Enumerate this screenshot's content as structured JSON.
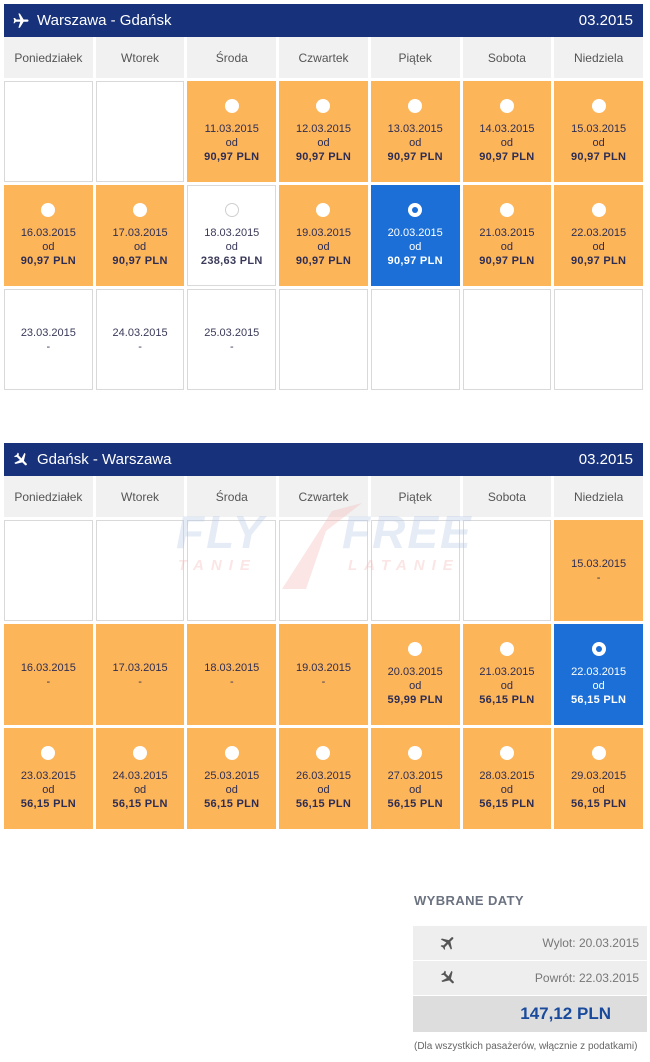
{
  "day_names": [
    "Poniedziałek",
    "Wtorek",
    "Środa",
    "Czwartek",
    "Piątek",
    "Sobota",
    "Niedziela"
  ],
  "icons": {
    "plane": "airplane-icon"
  },
  "colors": {
    "header": "#17317a",
    "available": "#fdb55a",
    "selected": "#1b6fd6",
    "total": "#1a4a9c"
  },
  "outbound": {
    "route": "Warszawa - Gdańsk",
    "month": "03.2015",
    "cells": [
      {
        "type": "empty"
      },
      {
        "type": "empty"
      },
      {
        "type": "orange",
        "date": "11.03.2015",
        "od": "od",
        "price": "90,97 PLN"
      },
      {
        "type": "orange",
        "date": "12.03.2015",
        "od": "od",
        "price": "90,97 PLN"
      },
      {
        "type": "orange",
        "date": "13.03.2015",
        "od": "od",
        "price": "90,97 PLN"
      },
      {
        "type": "orange",
        "date": "14.03.2015",
        "od": "od",
        "price": "90,97 PLN"
      },
      {
        "type": "orange",
        "date": "15.03.2015",
        "od": "od",
        "price": "90,97 PLN"
      },
      {
        "type": "orange",
        "date": "16.03.2015",
        "od": "od",
        "price": "90,97 PLN"
      },
      {
        "type": "orange",
        "date": "17.03.2015",
        "od": "od",
        "price": "90,97 PLN"
      },
      {
        "type": "white-priced",
        "date": "18.03.2015",
        "od": "od",
        "price": "238,63 PLN"
      },
      {
        "type": "orange",
        "date": "19.03.2015",
        "od": "od",
        "price": "90,97 PLN"
      },
      {
        "type": "selected",
        "date": "20.03.2015",
        "od": "od",
        "price": "90,97 PLN"
      },
      {
        "type": "orange",
        "date": "21.03.2015",
        "od": "od",
        "price": "90,97 PLN"
      },
      {
        "type": "orange",
        "date": "22.03.2015",
        "od": "od",
        "price": "90,97 PLN"
      },
      {
        "type": "white-nodata",
        "date": "23.03.2015",
        "dash": "-"
      },
      {
        "type": "white-nodata",
        "date": "24.03.2015",
        "dash": "-"
      },
      {
        "type": "white-nodata",
        "date": "25.03.2015",
        "dash": "-"
      },
      {
        "type": "empty"
      },
      {
        "type": "empty"
      },
      {
        "type": "empty"
      },
      {
        "type": "empty"
      }
    ]
  },
  "return": {
    "route": "Gdańsk - Warszawa",
    "month": "03.2015",
    "cells": [
      {
        "type": "empty"
      },
      {
        "type": "empty"
      },
      {
        "type": "empty"
      },
      {
        "type": "empty"
      },
      {
        "type": "empty"
      },
      {
        "type": "empty"
      },
      {
        "type": "orange-nodata",
        "date": "15.03.2015",
        "dash": "-"
      },
      {
        "type": "orange-nodata",
        "date": "16.03.2015",
        "dash": "-"
      },
      {
        "type": "orange-nodata",
        "date": "17.03.2015",
        "dash": "-"
      },
      {
        "type": "orange-nodata",
        "date": "18.03.2015",
        "dash": "-"
      },
      {
        "type": "orange-nodata",
        "date": "19.03.2015",
        "dash": "-"
      },
      {
        "type": "orange",
        "date": "20.03.2015",
        "od": "od",
        "price": "59,99 PLN"
      },
      {
        "type": "orange",
        "date": "21.03.2015",
        "od": "od",
        "price": "56,15 PLN"
      },
      {
        "type": "selected",
        "date": "22.03.2015",
        "od": "od",
        "price": "56,15 PLN"
      },
      {
        "type": "orange",
        "date": "23.03.2015",
        "od": "od",
        "price": "56,15 PLN"
      },
      {
        "type": "orange",
        "date": "24.03.2015",
        "od": "od",
        "price": "56,15 PLN"
      },
      {
        "type": "orange",
        "date": "25.03.2015",
        "od": "od",
        "price": "56,15 PLN"
      },
      {
        "type": "orange",
        "date": "26.03.2015",
        "od": "od",
        "price": "56,15 PLN"
      },
      {
        "type": "orange",
        "date": "27.03.2015",
        "od": "od",
        "price": "56,15 PLN"
      },
      {
        "type": "orange",
        "date": "28.03.2015",
        "od": "od",
        "price": "56,15 PLN"
      },
      {
        "type": "orange",
        "date": "29.03.2015",
        "od": "od",
        "price": "56,15 PLN"
      }
    ]
  },
  "watermark": {
    "fly": "FLY",
    "free": "FREE",
    "tanie": "TANIE",
    "latanie": "LATANIE"
  },
  "summary": {
    "title": "WYBRANE DATY",
    "departure": "Wylot: 20.03.2015",
    "return": "Powrót: 22.03.2015",
    "total": "147,12 PLN",
    "note": "(Dla wszystkich pasażerów, włącznie z podatkami)"
  }
}
